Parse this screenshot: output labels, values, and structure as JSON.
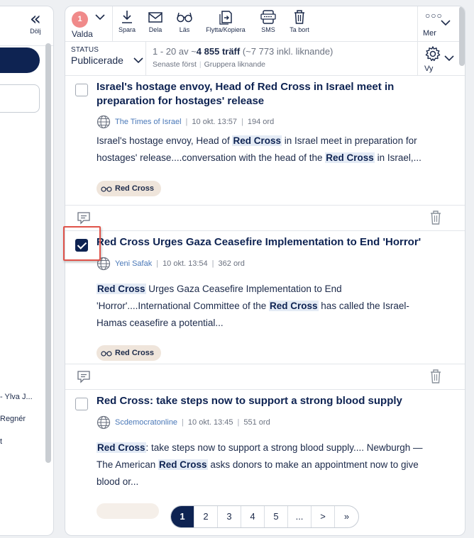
{
  "sidebar": {
    "collapse_label": "Dölj",
    "list_items": [
      "- Ylva J...",
      "Regnér",
      "t"
    ]
  },
  "toolbar": {
    "selected_count": "1",
    "selected_label": "Valda",
    "save_label": "Spara",
    "share_label": "Dela",
    "read_label": "Läs",
    "move_copy_label": "Flytta/Kopiera",
    "sms_label": "SMS",
    "delete_label": "Ta bort",
    "more_label": "Mer"
  },
  "status": {
    "label": "STATUS",
    "value": "Publicerade",
    "count_prefix": "1 - 20 av ~",
    "count_total": "4 855 träff",
    "count_suffix": " (~7 773 inkl. liknande)",
    "sort_label": "Senaste först",
    "group_label": "Gruppera liknande",
    "view_label": "Vy"
  },
  "articles": [
    {
      "title": "Israel's hostage envoy, Head of Red Cross in Israel meet in preparation for hostages' release",
      "source": "The Times of Israel",
      "date": "10 okt. 13:57",
      "words": "194 ord",
      "s1": "Israel's hostage envoy, Head of ",
      "h1": "Red Cross",
      "s2": " in Israel meet in preparation for hostages' release....conversation with the head of the ",
      "h2": "Red Cross",
      "s3": " in Israel,...",
      "tag": "Red Cross",
      "checked": false
    },
    {
      "title": "Red Cross Urges Gaza Ceasefire Implementation to End 'Horror'",
      "source": "Yeni Safak",
      "date": "10 okt. 13:54",
      "words": "362 ord",
      "h1": "Red Cross",
      "s2": " Urges Gaza Ceasefire Implementation to End 'Horror'....International Committee of the ",
      "h2": "Red Cross",
      "s3": " has called the Israel-Hamas ceasefire a potential...",
      "tag": "Red Cross",
      "checked": true
    },
    {
      "title": "Red Cross: take steps now to support a strong blood supply",
      "source": "Scdemocratonline",
      "date": "10 okt. 13:45",
      "words": "551 ord",
      "h1": "Red Cross",
      "s2": ": take steps now to support a strong blood supply.... Newburgh — The American ",
      "h2": "Red Cross",
      "s3": " asks donors to make an appointment now to give blood or...",
      "checked": false
    }
  ],
  "pagination": {
    "pages": [
      "1",
      "2",
      "3",
      "4",
      "5",
      "..."
    ],
    "next": ">",
    "last": "»"
  },
  "colors": {
    "navy": "#0e2352",
    "badge": "#f08a8a",
    "highlight_box": "#e0534a",
    "tag_bg": "#efe5db",
    "source_link": "#4a78b8"
  }
}
